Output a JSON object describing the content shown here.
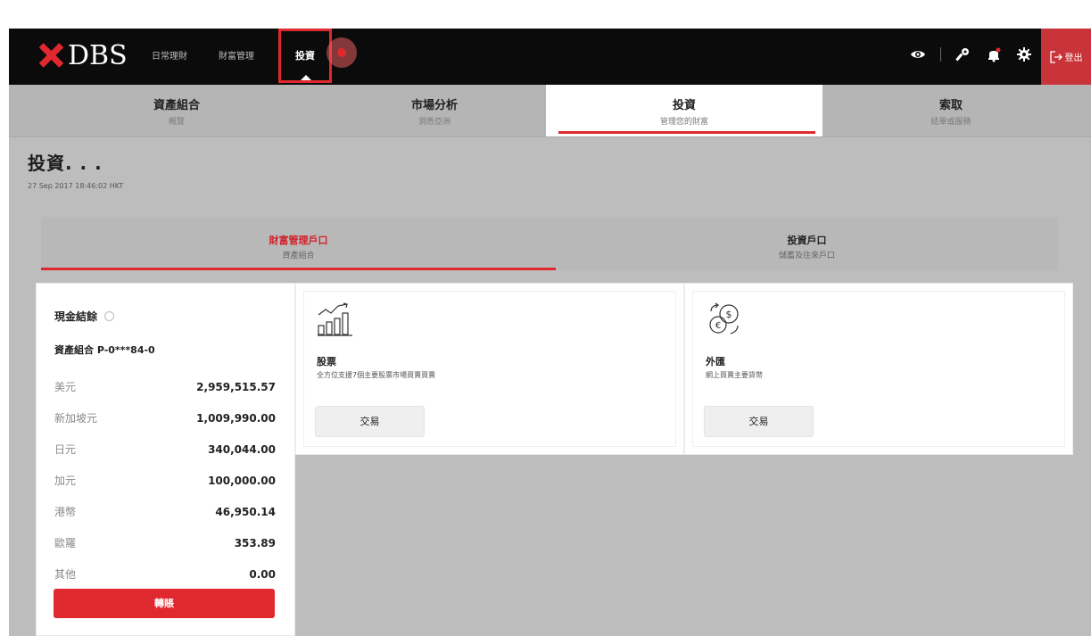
{
  "brand": {
    "logo_text": "DBS",
    "accent": "#e0282f"
  },
  "topnav": {
    "items": [
      {
        "label": "日常理財"
      },
      {
        "label": "財富管理"
      }
    ],
    "active_item": "投資",
    "right_icons": [
      "eye-icon",
      "key-icon",
      "bell-icon",
      "gear-icon"
    ],
    "logout_label": "登出"
  },
  "subtabs": [
    {
      "title": "資產組合",
      "subtitle": "概覽"
    },
    {
      "title": "市場分析",
      "subtitle": "洞悉亞洲"
    },
    {
      "title": "投資",
      "subtitle": "管理您的財富"
    },
    {
      "title": "索取",
      "subtitle": "結單或服務"
    }
  ],
  "page": {
    "title": "投資. . .",
    "timestamp": "27 Sep 2017 18:46:02 HKT"
  },
  "account_tabs": [
    {
      "title": "財富管理戶口",
      "subtitle": "資產組合"
    },
    {
      "title": "投資戶口",
      "subtitle": "儲蓄及往來戶口"
    }
  ],
  "cash_balance": {
    "title": "現金結餘",
    "portfolio": "資產組合 P-0***84-0",
    "rows": [
      {
        "currency": "美元",
        "amount": "2,959,515.57"
      },
      {
        "currency": "新加坡元",
        "amount": "1,009,990.00"
      },
      {
        "currency": "日元",
        "amount": "340,044.00"
      },
      {
        "currency": "加元",
        "amount": "100,000.00"
      },
      {
        "currency": "港幣",
        "amount": "46,950.14"
      },
      {
        "currency": "歐羅",
        "amount": "353.89"
      },
      {
        "currency": "其他",
        "amount": "0.00"
      }
    ],
    "transfer_label": "轉賬"
  },
  "cards": [
    {
      "icon": "stock-chart-icon",
      "title": "股票",
      "description": "全方位支援7個主要股票市場買賣買賣",
      "button": "交易"
    },
    {
      "icon": "currency-exchange-icon",
      "title": "外匯",
      "description": "網上買賣主要貨幣",
      "button": "交易"
    }
  ]
}
